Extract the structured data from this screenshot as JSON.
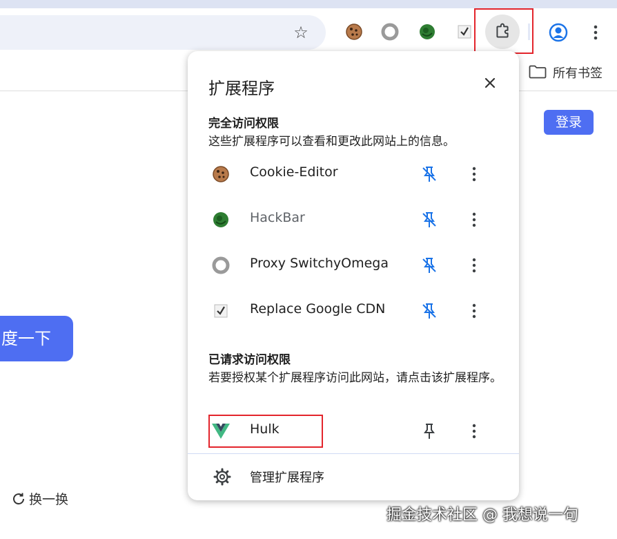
{
  "browser": {
    "bookmark_folder_label": "所有书签",
    "extension_icons": [
      "cookie-icon",
      "proxy-switchyomega-icon",
      "hackbar-icon",
      "replace-cdn-icon"
    ],
    "colors": {
      "accent": "#1a73e8",
      "highlight_box": "#e3242b"
    }
  },
  "page": {
    "login_label": "登录",
    "search_button_label": "度一下",
    "refresh_label": "换一换",
    "button_color": "#4e6ef2"
  },
  "extensions_panel": {
    "title": "扩展程序",
    "full_access": {
      "heading": "完全访问权限",
      "description": "这些扩展程序可以查看和更改此网站上的信息。",
      "items": [
        {
          "name": "Cookie-Editor",
          "icon": "cookie-icon",
          "pinned": true
        },
        {
          "name": "HackBar",
          "icon": "hackbar-icon",
          "pinned": true
        },
        {
          "name": "Proxy SwitchyOmega",
          "icon": "proxy-switchyomega-icon",
          "pinned": true
        },
        {
          "name": "Replace Google CDN",
          "icon": "replace-cdn-icon",
          "pinned": true
        }
      ]
    },
    "requested_access": {
      "heading": "已请求访问权限",
      "description": "若要授权某个扩展程序访问此网站，请点击该扩展程序。",
      "items": [
        {
          "name": "Hulk",
          "icon": "vue-logo-icon",
          "pinned": false
        }
      ]
    },
    "manage_label": "管理扩展程序"
  },
  "watermark": "掘金技术社区 @ 我想说一句"
}
